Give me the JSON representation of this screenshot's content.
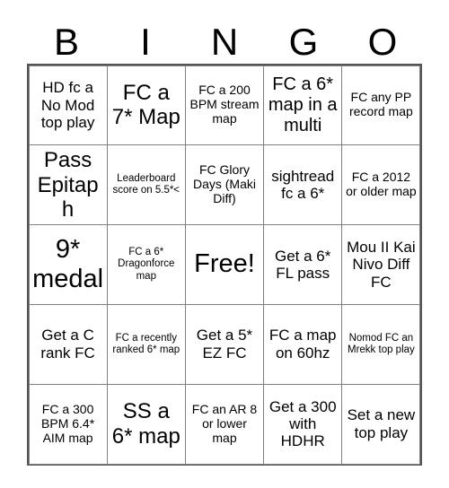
{
  "card": {
    "title": "BINGO",
    "header_letters": [
      "B",
      "I",
      "N",
      "G",
      "O"
    ],
    "columns": 5,
    "rows": 5,
    "free_space_index": 12,
    "colors": {
      "background": "#ffffff",
      "text": "#000000",
      "grid_line": "#808080",
      "grid_border": "#555555"
    },
    "cells": [
      {
        "text": "HD fc a No Mod top play",
        "size": "m"
      },
      {
        "text": "FC a 7* Map",
        "size": "xl"
      },
      {
        "text": "FC a 200 BPM stream map",
        "size": "s"
      },
      {
        "text": "FC a 6* map in a multi",
        "size": "l"
      },
      {
        "text": "FC any PP record map",
        "size": "s"
      },
      {
        "text": "Pass Epitaph",
        "size": "xl"
      },
      {
        "text": "Leaderboard score on 5.5*<",
        "size": "xs"
      },
      {
        "text": "FC Glory Days (Maki Diff)",
        "size": "s"
      },
      {
        "text": "sightread fc a 6*",
        "size": "m"
      },
      {
        "text": "FC a 2012 or older map",
        "size": "s"
      },
      {
        "text": "9* medal",
        "size": "xxl"
      },
      {
        "text": "FC a 6* Dragonforce map",
        "size": "xs"
      },
      {
        "text": "Free!",
        "size": "xxl"
      },
      {
        "text": "Get a 6* FL pass",
        "size": "m"
      },
      {
        "text": "Mou II Kai Nivo Diff FC",
        "size": "m"
      },
      {
        "text": "Get a C rank FC",
        "size": "m"
      },
      {
        "text": "FC a recently ranked 6* map",
        "size": "xs"
      },
      {
        "text": "Get a 5* EZ FC",
        "size": "m"
      },
      {
        "text": "FC a map on 60hz",
        "size": "m"
      },
      {
        "text": "Nomod FC an Mrekk top play",
        "size": "xs"
      },
      {
        "text": "FC a 300 BPM 6.4* AIM map",
        "size": "s"
      },
      {
        "text": "SS a 6* map",
        "size": "xl"
      },
      {
        "text": "FC an AR 8 or lower map",
        "size": "s"
      },
      {
        "text": "Get a 300 with HDHR",
        "size": "m"
      },
      {
        "text": "Set a new top play",
        "size": "m"
      }
    ]
  }
}
